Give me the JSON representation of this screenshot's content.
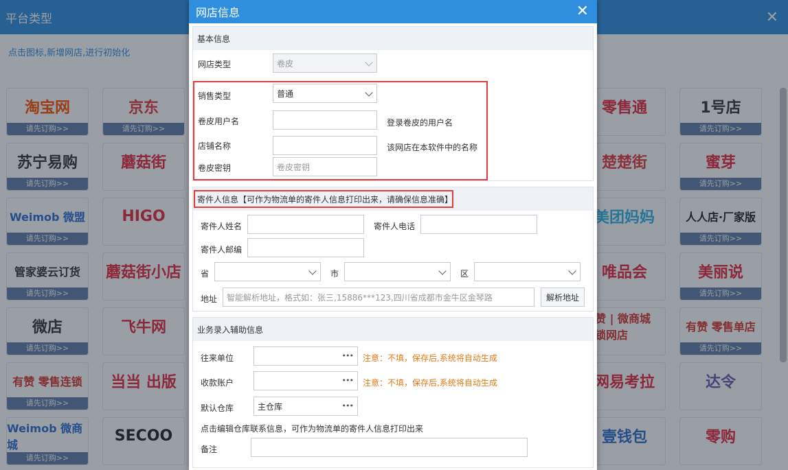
{
  "background": {
    "title": "平台类型",
    "hint": "点击图标,新增网店,进行初始化",
    "tiles": [
      {
        "name": "taobao",
        "logo": "淘宝网",
        "sub": "请先订购>>",
        "color": "#ff5000"
      },
      {
        "name": "jd",
        "logo": "京东",
        "sub": "请先订购>>",
        "color": "#e4393c"
      },
      {
        "name": "suning",
        "logo": "苏宁易购",
        "sub": "请先订购>>",
        "color": "#333333"
      },
      {
        "name": "mogujie",
        "logo": "蘑菇街",
        "sub": "",
        "color": "#e6293f"
      },
      {
        "name": "weimob",
        "logo": "Weimob 微盟",
        "sub": "请先订购>>",
        "color": "#2a6dd0"
      },
      {
        "name": "higo",
        "logo": "HIGO",
        "sub": "",
        "color": "#e6293f"
      },
      {
        "name": "guanjia",
        "logo": "管家婆云订货",
        "sub": "请先订购>>",
        "color": "#333333"
      },
      {
        "name": "mogujie-xd",
        "logo": "蘑菇街小店",
        "sub": "",
        "color": "#e6293f"
      },
      {
        "name": "weidian",
        "logo": "微店",
        "sub": "请先订购>>",
        "color": "#333333"
      },
      {
        "name": "feiniu",
        "logo": "飞牛网",
        "sub": "",
        "color": "#e6293f"
      },
      {
        "name": "youzan-ls",
        "logo": "有赞 零售连锁",
        "sub": "请先订购>>",
        "color": "#d4362c"
      },
      {
        "name": "dangdang",
        "logo": "当当 出版",
        "sub": "",
        "color": "#e6293f"
      },
      {
        "name": "weimob-wsc",
        "logo": "Weimob 微商城",
        "sub": "请先订购>>",
        "color": "#2a6dd0"
      },
      {
        "name": "secoo",
        "logo": "SECOO",
        "sub": "",
        "color": "#222222"
      },
      {
        "name": "alibaba-lst",
        "logo": "零售通",
        "sub": "",
        "color": "#e6293f"
      },
      {
        "name": "yhd",
        "logo": "1号店",
        "sub": "请先订购>>",
        "color": "#333333"
      },
      {
        "name": "chuchujie",
        "logo": "楚楚街",
        "sub": "",
        "color": "#e4393c"
      },
      {
        "name": "mia",
        "logo": "蜜芽",
        "sub": "请先订购>>",
        "color": "#e6293f"
      },
      {
        "name": "meituan-mama",
        "logo": "美团妈妈",
        "sub": "",
        "color": "#2db4e6"
      },
      {
        "name": "renrendian",
        "logo": "人人店·厂家版",
        "sub": "请先订购>>",
        "color": "#222222"
      },
      {
        "name": "vip",
        "logo": "唯品会",
        "sub": "",
        "color": "#e6293f"
      },
      {
        "name": "meilishuo",
        "logo": "美丽说",
        "sub": "请先订购>>",
        "color": "#e6293f"
      },
      {
        "name": "youzan-chain",
        "logo": "有赞 | 微商城 连锁网店",
        "sub": "",
        "color": "#d4362c"
      },
      {
        "name": "youzan-single",
        "logo": "有赞 零售单店",
        "sub": "请先订购>>",
        "color": "#d4362c"
      },
      {
        "name": "wangtou",
        "logo": "网易考拉",
        "sub": "",
        "color": "#e6293f"
      },
      {
        "name": "dala",
        "logo": "达令",
        "sub": "",
        "color": "#6e5aa8"
      },
      {
        "name": "yiqianbao",
        "logo": "壹钱包",
        "sub": "",
        "color": "#2a6dd0"
      },
      {
        "name": "linggou",
        "logo": "零购",
        "sub": "",
        "color": "#e6293f"
      }
    ]
  },
  "dialog": {
    "title": "网店信息",
    "basic": {
      "header": "基本信息",
      "store_type_label": "网店类型",
      "store_type_value": "卷皮",
      "sale_type_label": "销售类型",
      "sale_type_value": "普通",
      "username_label": "卷皮用户名",
      "username_note": "登录卷皮的用户名",
      "shopname_label": "店铺名称",
      "shopname_note": "该网店在本软件中的名称",
      "secret_label": "卷皮密钥",
      "secret_placeholder": "卷皮密钥"
    },
    "sender": {
      "header": "寄件人信息【可作为物流单的寄件人信息打印出来，请确保信息准确】",
      "name_label": "寄件人姓名",
      "phone_label": "寄件人电话",
      "zip_label": "寄件人邮编",
      "province_label": "省",
      "city_label": "市",
      "district_label": "区",
      "address_label": "地址",
      "address_placeholder": "智能解析地址，格式如：张三,15886***123,四川省成都市金牛区金琴路",
      "parse_button": "解析地址"
    },
    "business": {
      "header": "业务录入辅助信息",
      "partner_label": "往来单位",
      "partner_warn": "注意：不填，保存后,系统将自动生成",
      "account_label": "收款账户",
      "account_warn": "注意：不填，保存后,系统将自动生成",
      "warehouse_label": "默认仓库",
      "warehouse_value": "主仓库",
      "warehouse_note": "点击编辑仓库联系信息，可作为物流单的寄件人信息打印出来",
      "remark_label": "备注"
    }
  }
}
